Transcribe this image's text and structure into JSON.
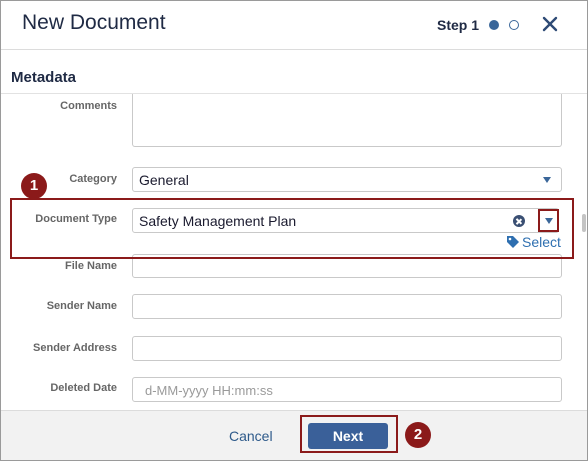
{
  "header": {
    "title": "New Document",
    "step_label": "Step 1",
    "close_icon": "close-icon"
  },
  "section": {
    "title": "Metadata"
  },
  "fields": {
    "comments_label": "Comments",
    "category_label": "Category",
    "category_value": "General",
    "document_type_label": "Document Type",
    "document_type_value": "Safety Management Plan",
    "select_link": "Select",
    "file_name_label": "File Name",
    "file_name_value": "",
    "sender_name_label": "Sender Name",
    "sender_name_value": "",
    "sender_address_label": "Sender Address",
    "sender_address_value": "",
    "deleted_date_label": "Deleted Date",
    "deleted_date_placeholder": "d-MM-yyyy HH:mm:ss"
  },
  "footer": {
    "cancel_label": "Cancel",
    "next_label": "Next"
  },
  "annotations": {
    "badge_1": "1",
    "badge_2": "2"
  },
  "colors": {
    "accent": "#3a6099",
    "highlight": "#8b1a1a",
    "title": "#1f2a44"
  }
}
